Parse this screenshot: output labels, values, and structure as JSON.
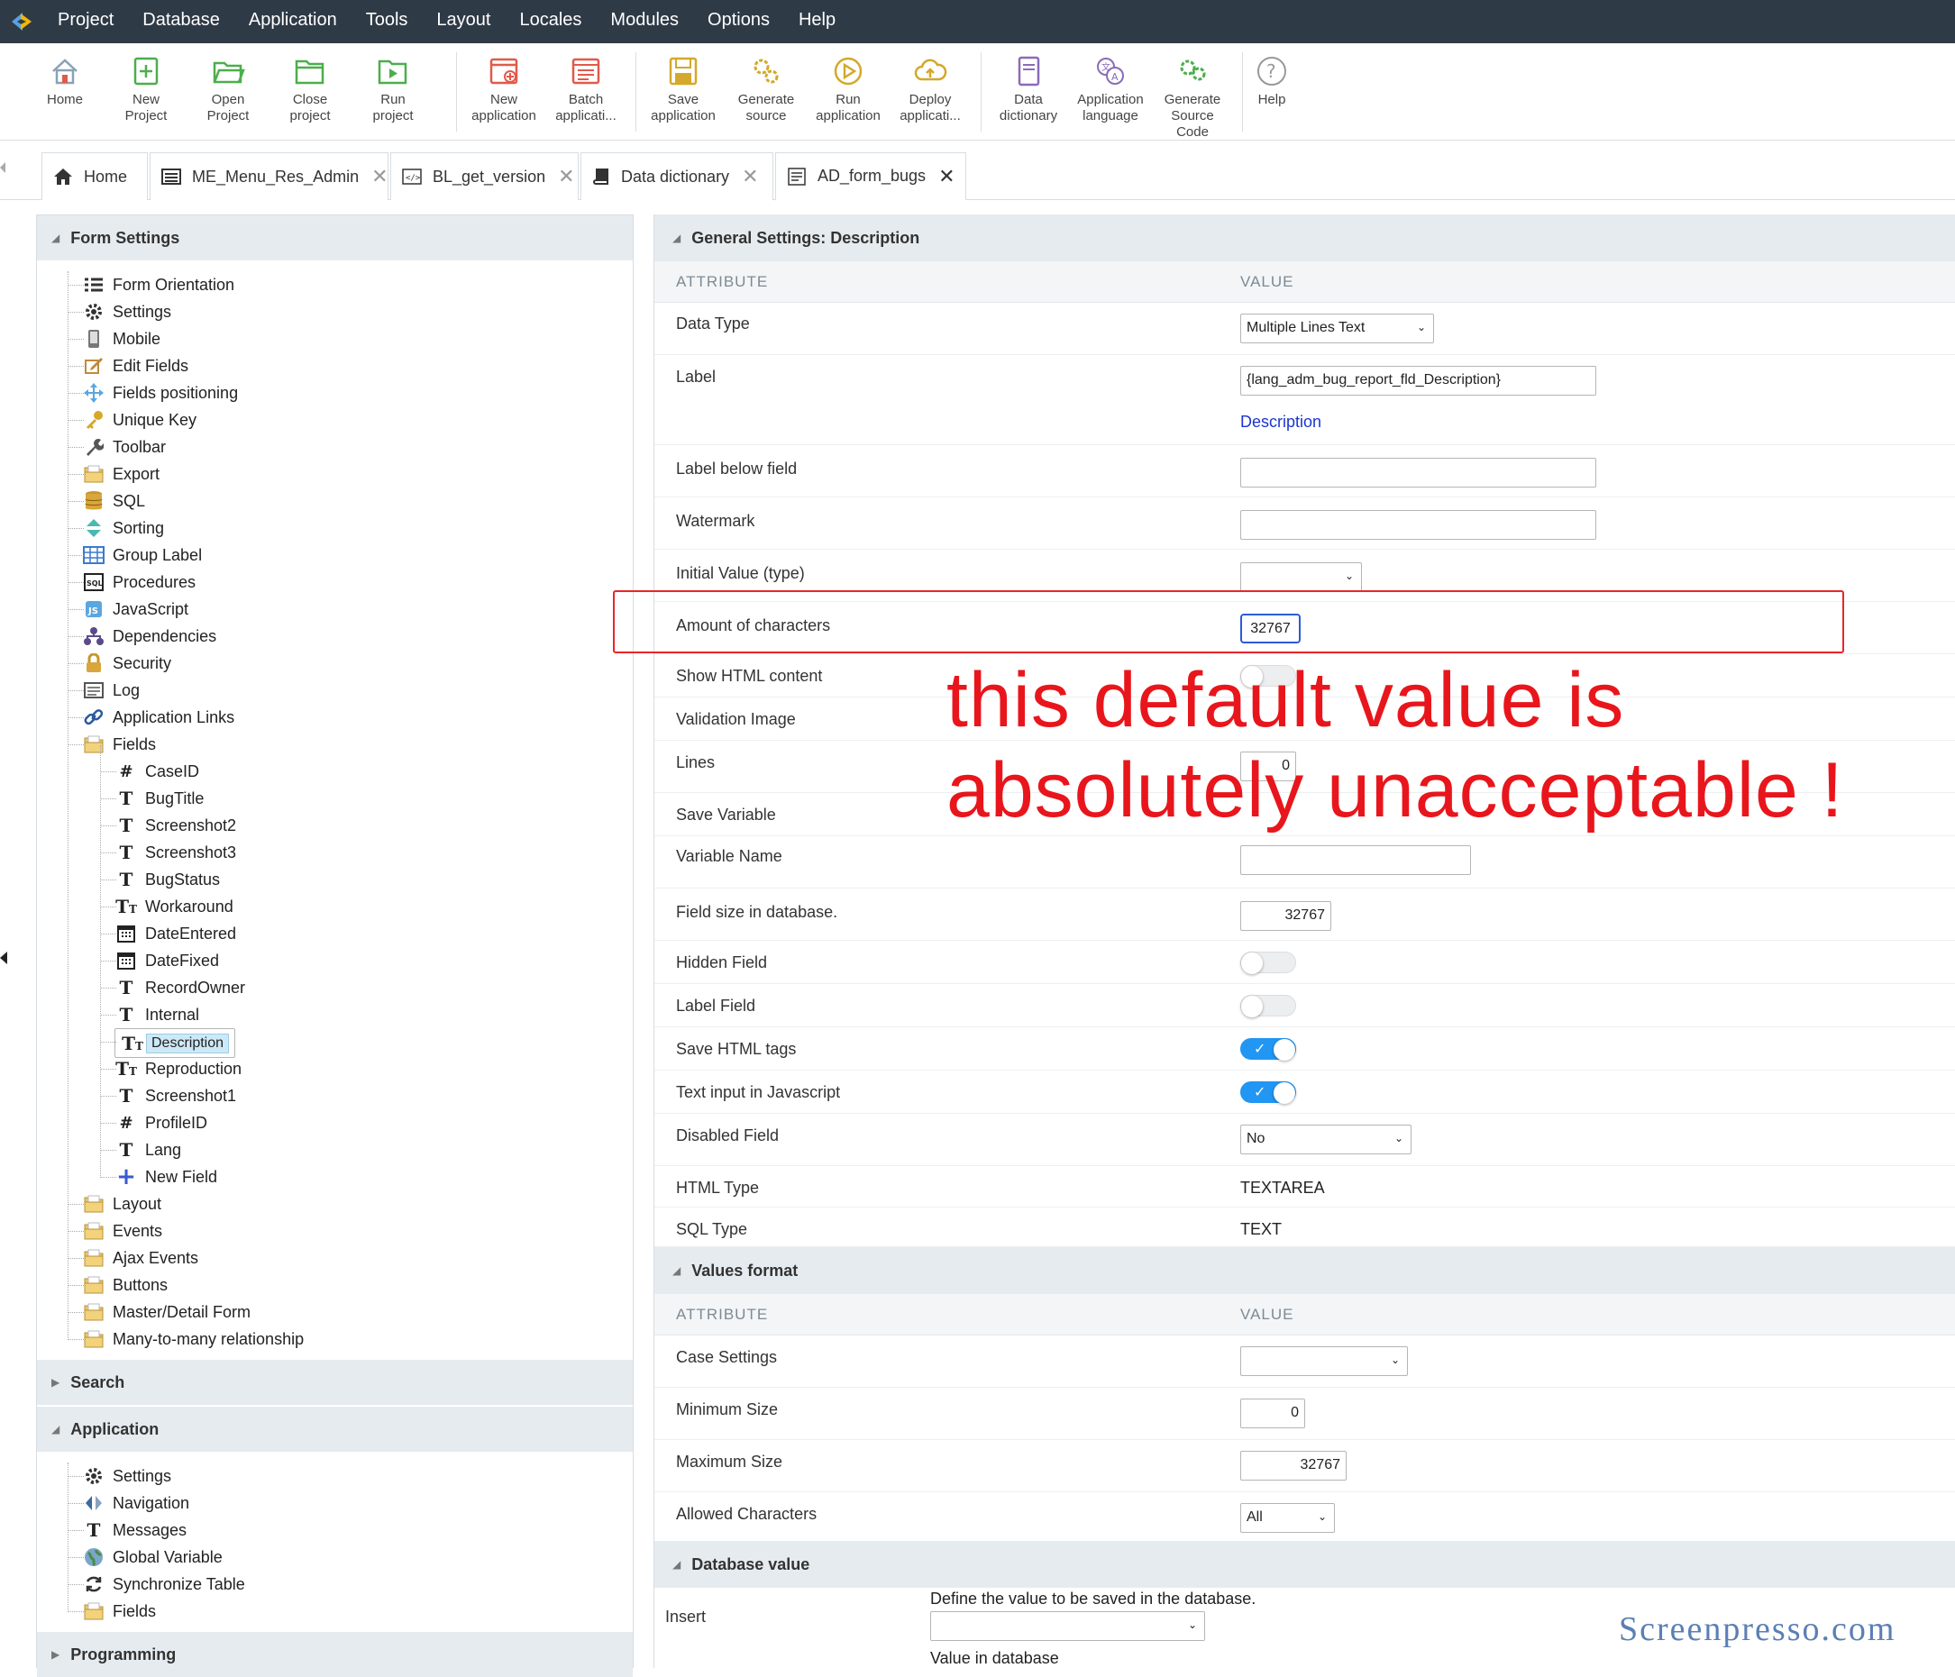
{
  "menubar": {
    "items": [
      "Project",
      "Database",
      "Application",
      "Tools",
      "Layout",
      "Locales",
      "Modules",
      "Options",
      "Help"
    ]
  },
  "toolbar": {
    "buttons": [
      {
        "label1": "Home",
        "label2": "",
        "icon": "home-icon"
      },
      {
        "label1": "New",
        "label2": "Project",
        "icon": "new-project-icon"
      },
      {
        "label1": "Open",
        "label2": "Project",
        "icon": "open-project-icon"
      },
      {
        "label1": "Close",
        "label2": "project",
        "icon": "close-project-icon"
      },
      {
        "label1": "Run",
        "label2": "project",
        "icon": "run-project-icon"
      },
      {
        "label1": "New",
        "label2": "application",
        "icon": "new-application-icon"
      },
      {
        "label1": "Batch",
        "label2": "applicati...",
        "icon": "batch-application-icon"
      },
      {
        "label1": "Save",
        "label2": "application",
        "icon": "save-application-icon"
      },
      {
        "label1": "Generate",
        "label2": "source",
        "icon": "generate-source-icon"
      },
      {
        "label1": "Run",
        "label2": "application",
        "icon": "run-application-icon"
      },
      {
        "label1": "Deploy",
        "label2": "applicati...",
        "icon": "deploy-application-icon"
      },
      {
        "label1": "Data",
        "label2": "dictionary",
        "icon": "data-dictionary-icon"
      },
      {
        "label1": "Application",
        "label2": "language",
        "icon": "application-language-icon"
      },
      {
        "label1": "Generate",
        "label2": "Source",
        "label3": "Code",
        "icon": "generate-source-code-icon"
      },
      {
        "label1": "Help",
        "label2": "",
        "icon": "help-icon"
      }
    ]
  },
  "tabs": [
    {
      "label": "Home",
      "icon": "home-icon"
    },
    {
      "label": "ME_Menu_Res_Admin",
      "icon": "menu-icon"
    },
    {
      "label": "BL_get_version",
      "icon": "code-icon"
    },
    {
      "label": "Data dictionary",
      "icon": "book-icon"
    },
    {
      "label": "AD_form_bugs",
      "icon": "form-icon",
      "active": true
    }
  ],
  "left": {
    "form_settings_title": "Form Settings",
    "form_items": [
      {
        "label": "Form Orientation",
        "icon": "list-icon"
      },
      {
        "label": "Settings",
        "icon": "gear-icon"
      },
      {
        "label": "Mobile",
        "icon": "mobile-icon"
      },
      {
        "label": "Edit Fields",
        "icon": "edit-icon"
      },
      {
        "label": "Fields positioning",
        "icon": "move-icon"
      },
      {
        "label": "Unique Key",
        "icon": "key-icon"
      },
      {
        "label": "Toolbar",
        "icon": "wrench-icon"
      },
      {
        "label": "Export",
        "icon": "folder-icon"
      },
      {
        "label": "SQL",
        "icon": "database-icon"
      },
      {
        "label": "Sorting",
        "icon": "sort-icon"
      },
      {
        "label": "Group Label",
        "icon": "table-icon"
      },
      {
        "label": "Procedures",
        "icon": "sql-icon"
      },
      {
        "label": "JavaScript",
        "icon": "javascript-icon"
      },
      {
        "label": "Dependencies",
        "icon": "dependencies-icon"
      },
      {
        "label": "Security",
        "icon": "lock-icon"
      },
      {
        "label": "Log",
        "icon": "log-icon"
      },
      {
        "label": "Application Links",
        "icon": "link-icon"
      },
      {
        "label": "Fields",
        "icon": "folder-icon"
      }
    ],
    "field_items": [
      {
        "label": "CaseID",
        "glyph": "#"
      },
      {
        "label": "BugTitle",
        "glyph": "T"
      },
      {
        "label": "Screenshot2",
        "glyph": "T"
      },
      {
        "label": "Screenshot3",
        "glyph": "T"
      },
      {
        "label": "BugStatus",
        "glyph": "T"
      },
      {
        "label": "Workaround",
        "glyph": "Tт"
      },
      {
        "label": "DateEntered",
        "glyph": "cal"
      },
      {
        "label": "DateFixed",
        "glyph": "cal"
      },
      {
        "label": "RecordOwner",
        "glyph": "T"
      },
      {
        "label": "Internal",
        "glyph": "T"
      },
      {
        "label": "Description",
        "glyph": "Tт",
        "selected": true
      },
      {
        "label": "Reproduction",
        "glyph": "Tт"
      },
      {
        "label": "Screenshot1",
        "glyph": "T"
      },
      {
        "label": "ProfileID",
        "glyph": "#"
      },
      {
        "label": "Lang",
        "glyph": "T"
      },
      {
        "label": "New Field",
        "glyph": "+"
      }
    ],
    "after_items": [
      {
        "label": "Layout"
      },
      {
        "label": "Events"
      },
      {
        "label": "Ajax Events"
      },
      {
        "label": "Buttons"
      },
      {
        "label": "Master/Detail Form"
      },
      {
        "label": "Many-to-many relationship"
      }
    ],
    "search_title": "Search",
    "application_title": "Application",
    "app_items": [
      {
        "label": "Settings",
        "icon": "gear-icon"
      },
      {
        "label": "Navigation",
        "icon": "navigation-icon"
      },
      {
        "label": "Messages",
        "icon": "text-icon"
      },
      {
        "label": "Global Variable",
        "icon": "globe-icon"
      },
      {
        "label": "Synchronize Table",
        "icon": "sync-icon"
      },
      {
        "label": "Fields",
        "icon": "folder-icon"
      }
    ],
    "programming_title": "Programming"
  },
  "right": {
    "general_title": "General Settings: Description",
    "col_attribute": "ATTRIBUTE",
    "col_value": "VALUE",
    "data_type_label": "Data Type",
    "data_type_value": "Multiple Lines Text",
    "label_label": "Label",
    "label_value": "{lang_adm_bug_report_fld_Description}",
    "label_link": "Description",
    "label_below_label": "Label below field",
    "watermark_label": "Watermark",
    "initial_value_label": "Initial Value (type)",
    "amount_label": "Amount of characters",
    "amount_value": "32767",
    "show_html_label": "Show HTML content",
    "validation_image_label": "Validation Image",
    "lines_label": "Lines",
    "lines_value": "0",
    "save_variable_label": "Save Variable",
    "variable_name_label": "Variable Name",
    "field_size_label": "Field size in database.",
    "field_size_value": "32767",
    "hidden_field_label": "Hidden Field",
    "label_field_label": "Label Field",
    "save_html_tags_label": "Save HTML tags",
    "text_input_js_label": "Text input in Javascript",
    "disabled_field_label": "Disabled Field",
    "disabled_field_value": "No",
    "html_type_label": "HTML Type",
    "html_type_value": "TEXTAREA",
    "sql_type_label": "SQL Type",
    "sql_type_value": "TEXT",
    "values_format_title": "Values format",
    "case_settings_label": "Case Settings",
    "min_size_label": "Minimum Size",
    "min_size_value": "0",
    "max_size_label": "Maximum Size",
    "max_size_value": "32767",
    "allowed_chars_label": "Allowed Characters",
    "allowed_chars_value": "All",
    "database_value_title": "Database value",
    "insert_label": "Insert",
    "insert_hint": "Define the value to be saved in the database.",
    "value_in_db_label": "Value in database"
  },
  "annotation": {
    "line1": "this default value is",
    "line2": "absolutely unacceptable !"
  },
  "watermark": "Screenpresso.com",
  "colors": {
    "menubar": "#2f3a47",
    "section_header": "#e6ebef",
    "annotation": "#e8161c",
    "toggle_on": "#2196f3",
    "selection": "#cde8f6"
  }
}
